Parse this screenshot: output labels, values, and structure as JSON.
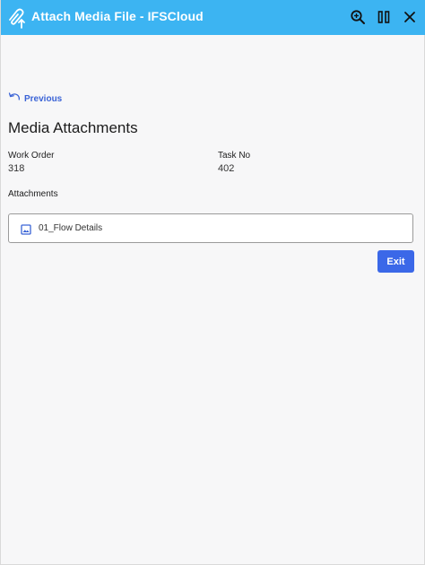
{
  "header": {
    "title": "Attach Media File - IFSCloud",
    "app_icon": "paperclip-upload-icon",
    "actions": [
      {
        "icon": "zoom-search-icon"
      },
      {
        "icon": "pause-columns-icon"
      },
      {
        "icon": "close-icon"
      }
    ],
    "background": "#3cb4f2"
  },
  "navigation": {
    "previous_label": "Previous",
    "previous_icon": "undo-arrow-icon"
  },
  "page": {
    "title": "Media Attachments"
  },
  "fields": {
    "work_order": {
      "label": "Work Order",
      "value": "318"
    },
    "task_no": {
      "label": "Task No",
      "value": "402"
    }
  },
  "attachments": {
    "label": "Attachments",
    "items": [
      {
        "name": "01_Flow Details",
        "icon": "image-icon"
      }
    ]
  },
  "actions": {
    "exit_label": "Exit",
    "exit_color": "#3b68e8"
  },
  "colors": {
    "accent": "#3a63d6",
    "background": "#f7f7f8"
  }
}
